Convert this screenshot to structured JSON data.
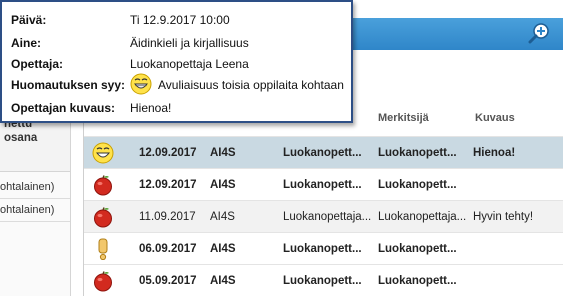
{
  "tooltip": {
    "fields": [
      {
        "label": "Päivä:",
        "value": "Ti 12.9.2017 10:00"
      },
      {
        "label": "Aine:",
        "value": "Äidinkieli ja kirjallisuus"
      },
      {
        "label": "Opettaja:",
        "value": "Luokanopettaja Leena"
      },
      {
        "label": "Huomautuksen syy:",
        "value": "Avuliaisuus toisia oppilaita kohtaan",
        "icon": "smiley-icon"
      },
      {
        "label": "Opettajan kuvaus:",
        "value": "Hienoa!"
      }
    ]
  },
  "toolbar": {
    "zoom_icon": "zoom-in-icon"
  },
  "left_panel": {
    "heading_line1": "nettu",
    "heading_line2": "osana",
    "rows": [
      "ohtalainen)",
      "ohtalainen)"
    ]
  },
  "table": {
    "headers": {
      "merkitsija": "Merkitsijä",
      "kuvaus": "Kuvaus"
    },
    "rows": [
      {
        "icon": "smiley-icon",
        "date": "12.09.2017",
        "group": "AI4S",
        "teacher": "Luokanopett...",
        "marker": "Luokanopett...",
        "desc": "Hienoa!",
        "bold": true,
        "selected": true
      },
      {
        "icon": "apple-icon",
        "date": "12.09.2017",
        "group": "AI4S",
        "teacher": "Luokanopett...",
        "marker": "Luokanopett...",
        "desc": "",
        "bold": true,
        "selected": false
      },
      {
        "icon": "apple-icon",
        "date": "11.09.2017",
        "group": "AI4S",
        "teacher": "Luokanopettaja...",
        "marker": "Luokanopettaja...",
        "desc": "Hyvin tehty!",
        "bold": false,
        "selected": false
      },
      {
        "icon": "exclamation-icon",
        "date": "06.09.2017",
        "group": "AI4S",
        "teacher": "Luokanopett...",
        "marker": "Luokanopett...",
        "desc": "",
        "bold": true,
        "selected": false
      },
      {
        "icon": "apple-icon",
        "date": "05.09.2017",
        "group": "AI4S",
        "teacher": "Luokanopett...",
        "marker": "Luokanopett...",
        "desc": "",
        "bold": true,
        "selected": false
      }
    ]
  },
  "colors": {
    "accent": "#2f86c9",
    "tooltip_border": "#2d4f86",
    "selected_row": "#c9d9e2"
  }
}
